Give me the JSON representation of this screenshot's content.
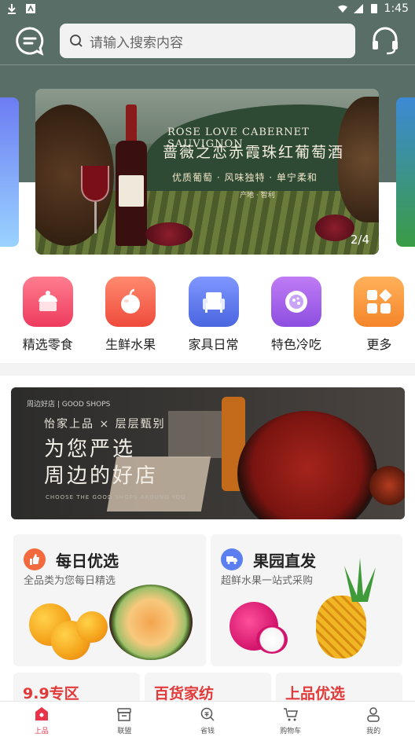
{
  "status_bar": {
    "time": "1:45"
  },
  "search": {
    "placeholder": "请输入搜索内容"
  },
  "banner": {
    "en_title": "ROSE LOVE CABERNET SAUVIGNON",
    "cn_title": "蔷薇之恋赤霞珠红葡萄酒",
    "tagline": "优质葡萄 · 风味独特 · 单宁柔和",
    "origin": "产地 · 智利",
    "counter": "2/4"
  },
  "categories": [
    {
      "label": "精选零食",
      "icon": "cake-icon",
      "color": "#f0546e"
    },
    {
      "label": "生鲜水果",
      "icon": "apple-icon",
      "color": "#f25f4a"
    },
    {
      "label": "家具日常",
      "icon": "sofa-icon",
      "color": "#5a78e6"
    },
    {
      "label": "特色冷吃",
      "icon": "dish-icon",
      "color": "#9d5ee0"
    },
    {
      "label": "更多",
      "icon": "grid-more-icon",
      "color": "#f79a34"
    }
  ],
  "promo": {
    "shop_tag": "周边好店 | GOOD SHOPS",
    "line1": "怡家上品 × 层层甄别",
    "big1": "为您严选",
    "big2": "周边的好店",
    "en_line": "CHOOSE THE GOOD SHOPS AROUND YOU"
  },
  "cards": [
    {
      "title": "每日优选",
      "subtitle": "全品类为您每日精选",
      "icon": "thumbs-up-icon",
      "color": "#f26a3d"
    },
    {
      "title": "果园直发",
      "subtitle": "超鲜水果一站式采购",
      "icon": "truck-icon",
      "color": "#5b7ff0"
    }
  ],
  "mini_cards": [
    {
      "title": "9.9专区",
      "color": "#e23a3a"
    },
    {
      "title": "百货家纺",
      "color": "#e23a3a"
    },
    {
      "title": "上品优选",
      "color": "#e23a3a"
    }
  ],
  "tabbar": {
    "items": [
      {
        "label": "上品",
        "icon": "home-icon"
      },
      {
        "label": "联盟",
        "icon": "shop-icon"
      },
      {
        "label": "省钱",
        "icon": "search-money-icon"
      },
      {
        "label": "购物车",
        "icon": "cart-icon"
      },
      {
        "label": "我的",
        "icon": "user-icon"
      }
    ],
    "active_color": "#e8334a"
  }
}
